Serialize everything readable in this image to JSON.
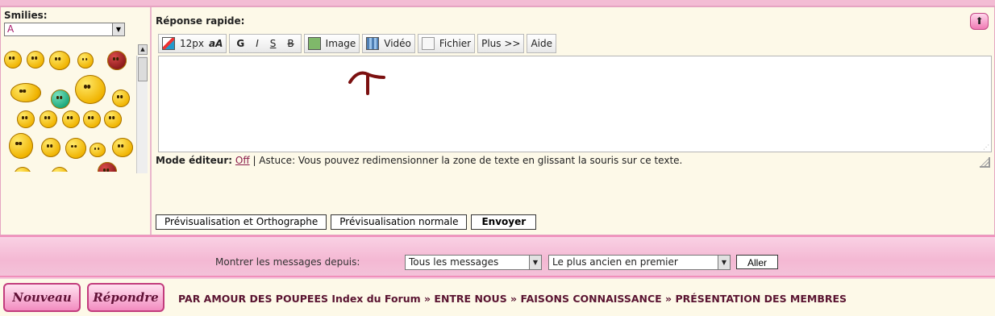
{
  "smilies": {
    "title": "Smilies:",
    "category_value": "A"
  },
  "reply": {
    "title": "Réponse rapide:",
    "toolbar": {
      "font_size": "12px",
      "font_toggle": "aA",
      "bold": "G",
      "italic": "I",
      "strike_s": "S",
      "strike_b": "B",
      "image": "Image",
      "video": "Vidéo",
      "file": "Fichier",
      "more": "Plus >>",
      "help": "Aide"
    },
    "mode_label": "Mode éditeur:",
    "mode_value": "Off",
    "mode_tip": "| Astuce: Vous pouvez redimensionner la zone de texte en glissant la souris sur ce texte.",
    "buttons": {
      "preview_spell": "Prévisualisation et Orthographe",
      "preview_normal": "Prévisualisation normale",
      "send": "Envoyer"
    }
  },
  "filter": {
    "label": "Montrer les messages depuis:",
    "since_value": "Tous les messages",
    "order_value": "Le plus ancien en premier",
    "go": "Aller"
  },
  "footer": {
    "new_label": "Nouveau",
    "reply_label": "Répondre",
    "breadcrumb": "PAR AMOUR DES POUPEES Index du Forum » ENTRE NOUS » FAISONS CONNAISSANCE » PRÉSENTATION DES MEMBRES"
  },
  "colors": {
    "panel_bg": "#fdf9e8",
    "pink_bar": "#f4b8d3",
    "breadcrumb": "#5a1431"
  }
}
